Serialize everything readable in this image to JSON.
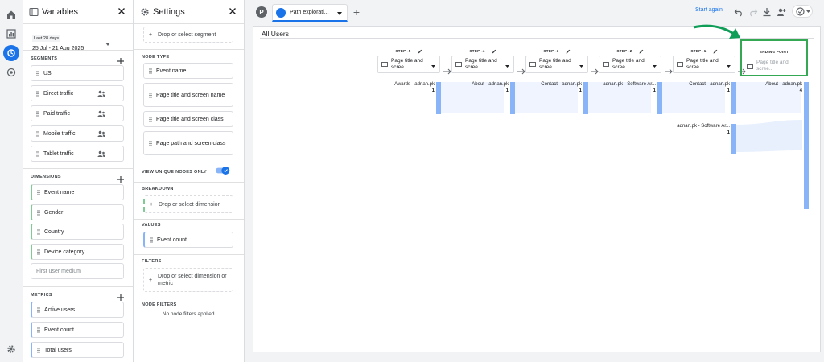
{
  "variables_panel": {
    "title": "Variables",
    "date_range": {
      "label": "Last 28 days",
      "value": "25 Jul - 21 Aug 2025"
    },
    "segments": {
      "heading": "SEGMENTS",
      "items": [
        "US",
        "Direct traffic",
        "Paid traffic",
        "Mobile traffic",
        "Tablet traffic"
      ]
    },
    "dimensions": {
      "heading": "DIMENSIONS",
      "items": [
        "Event name",
        "Gender",
        "Country",
        "Device category"
      ],
      "placeholder": "First user medium"
    },
    "metrics": {
      "heading": "METRICS",
      "items": [
        "Active users",
        "Event count",
        "Total users"
      ]
    }
  },
  "settings_panel": {
    "title": "Settings",
    "segment_drop": "Drop or select segment",
    "node_type": {
      "heading": "NODE TYPE",
      "items": [
        "Event name",
        "Page title and screen name",
        "Page title and screen class",
        "Page path and screen class"
      ]
    },
    "unique_nodes": {
      "label": "VIEW UNIQUE NODES ONLY",
      "enabled": true
    },
    "breakdown": {
      "heading": "BREAKDOWN",
      "drop": "Drop or select dimension"
    },
    "values": {
      "heading": "VALUES",
      "item": "Event count"
    },
    "filters": {
      "heading": "FILTERS",
      "drop": "Drop or select dimension or metric"
    },
    "node_filters": {
      "heading": "NODE FILTERS",
      "text": "No node filters applied."
    }
  },
  "toolbar": {
    "avatar_letter": "P",
    "tab_label": "Path explorati...",
    "start_again": "Start again",
    "icons": [
      "undo-icon",
      "redo-icon",
      "download-icon",
      "share-user-icon",
      "check-status-icon"
    ]
  },
  "exploration": {
    "segment_title": "All Users",
    "node_type_label": "Page title and scree...",
    "steps": [
      {
        "label": "STEP -5"
      },
      {
        "label": "STEP -4"
      },
      {
        "label": "STEP -3"
      },
      {
        "label": "STEP -2"
      },
      {
        "label": "STEP -1"
      }
    ],
    "ending_point": {
      "label": "ENDING POINT",
      "placeholder": "Page title and scree..."
    },
    "nodes": [
      {
        "label": "Awards - adnan.pk",
        "count": "1"
      },
      {
        "label": "About - adnan.pk",
        "count": "1"
      },
      {
        "label": "Contact - adnan.pk",
        "count": "1"
      },
      {
        "label": "adnan.pk - Software Ar...",
        "count": "1"
      },
      {
        "label": "Contact - adnan.pk",
        "count": "1"
      },
      {
        "label": "About - adnan.pk",
        "count": "4"
      },
      {
        "label": "adnan.pk - Software Ar...",
        "count": "1"
      }
    ]
  },
  "colors": {
    "accent": "#1a73e8",
    "bar": "#8ab4f8",
    "highlight": "#34a853",
    "arrow": "#0f9d58"
  }
}
